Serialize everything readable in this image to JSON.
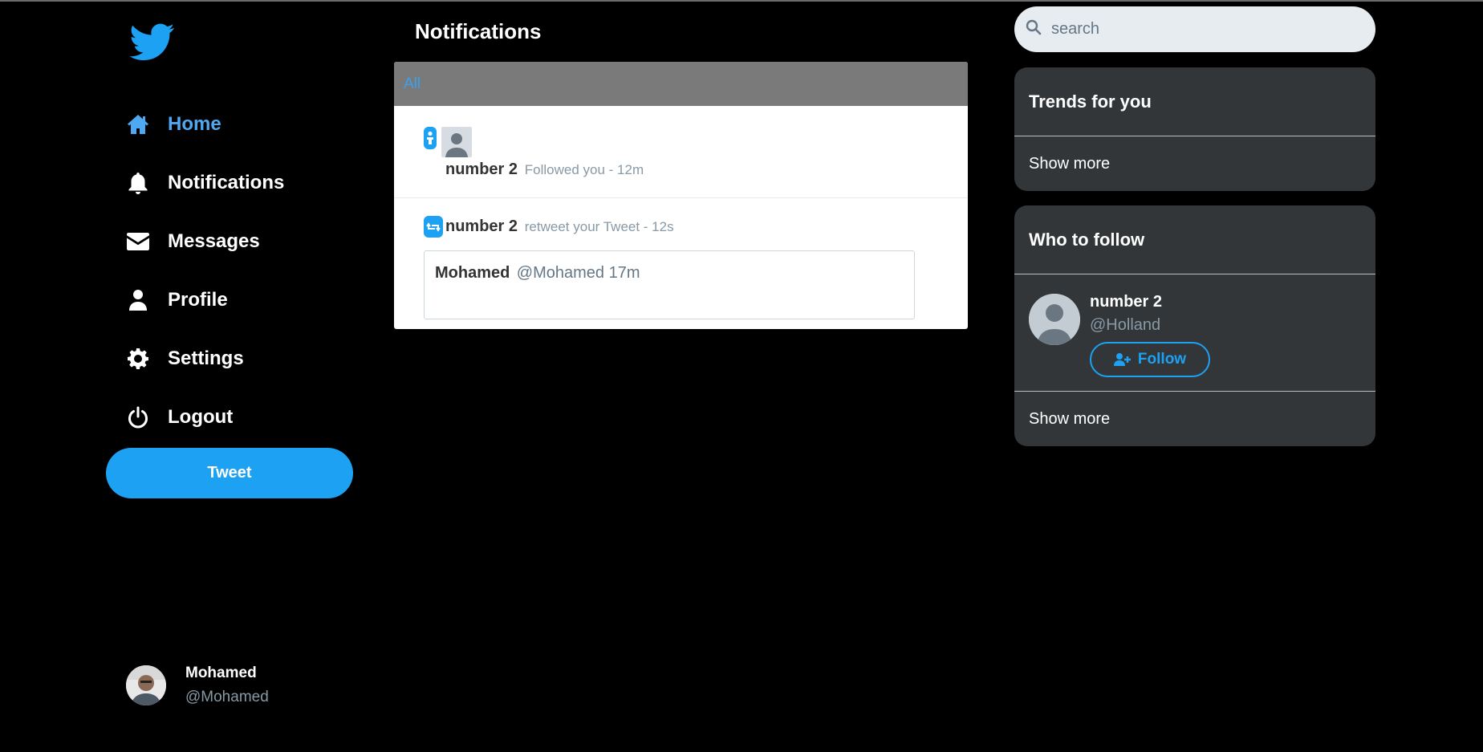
{
  "sidebar": {
    "nav": [
      {
        "label": "Home",
        "icon": "home-icon",
        "active": true
      },
      {
        "label": "Notifications",
        "icon": "bell-icon",
        "active": false
      },
      {
        "label": "Messages",
        "icon": "envelope-icon",
        "active": false
      },
      {
        "label": "Profile",
        "icon": "user-icon",
        "active": false
      },
      {
        "label": "Settings",
        "icon": "gear-icon",
        "active": false
      },
      {
        "label": "Logout",
        "icon": "power-icon",
        "active": false
      }
    ],
    "tweet_label": "Tweet",
    "account": {
      "name": "Mohamed",
      "handle": "@Mohamed"
    }
  },
  "main": {
    "title": "Notifications",
    "tabs": [
      {
        "label": "All"
      }
    ],
    "notifications": [
      {
        "type": "follow",
        "user": "number 2",
        "text": "Followed you - 12m"
      },
      {
        "type": "retweet",
        "user": "number 2",
        "text": "retweet your Tweet - 12s",
        "quoted": {
          "name": "Mohamed",
          "meta": "@Mohamed 17m"
        }
      }
    ]
  },
  "right": {
    "search": {
      "placeholder": "search"
    },
    "trends": {
      "title": "Trends for you",
      "show_more": "Show more"
    },
    "who_to_follow": {
      "title": "Who to follow",
      "suggestion": {
        "name": "number 2",
        "handle": "@Holland",
        "follow_label": "Follow"
      },
      "show_more": "Show more"
    }
  },
  "colors": {
    "accent": "#1da1f2",
    "active_nav": "#4fa9f2",
    "card_bg": "#323638",
    "tab_bar": "#7a7a7a"
  }
}
